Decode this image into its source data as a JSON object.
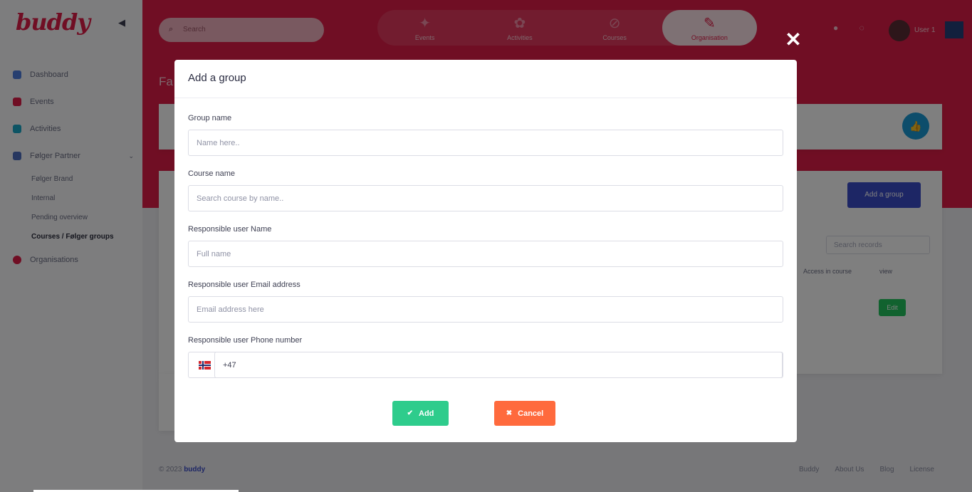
{
  "app": {
    "logo": "buddy",
    "sidebar": {
      "items": [
        {
          "label": "Dashboard",
          "color": "#4f7fe0"
        },
        {
          "label": "Events",
          "color": "#e11d48"
        },
        {
          "label": "Activities",
          "color": "#1aa9c9"
        },
        {
          "label": "Følger Partner",
          "color": "#4f6fc0"
        }
      ],
      "subitems": [
        {
          "label": "Følger Brand"
        },
        {
          "label": "Internal"
        },
        {
          "label": "Pending overview"
        },
        {
          "label": "Courses / Følger groups"
        }
      ],
      "extra_item": {
        "label": "Organisations",
        "color": "#e11d48"
      }
    },
    "header": {
      "search_placeholder": "Search",
      "tabs": [
        {
          "label": "Events"
        },
        {
          "label": "Activities"
        },
        {
          "label": "Courses"
        },
        {
          "label": "Organisation"
        }
      ],
      "user_name": "User 1"
    },
    "page_label": "Fa",
    "bg_button": "Add a group",
    "bg_search": "Search records",
    "bg_headers": [
      "Access in course",
      "view"
    ],
    "bg_tag": "Edit",
    "footer": {
      "copyright": "© 2023",
      "brand": "buddy",
      "links": [
        "Buddy",
        "About Us",
        "Blog",
        "License"
      ]
    }
  },
  "modal": {
    "close_symbol": "✕",
    "title": "Add a group",
    "fields": {
      "group_name": {
        "label": "Group name",
        "placeholder": "Name here.."
      },
      "course_name": {
        "label": "Course name",
        "placeholder": "Search course by name.."
      },
      "user_name": {
        "label": "Responsible user Name",
        "placeholder": "Full name"
      },
      "user_email": {
        "label": "Responsible user Email address",
        "placeholder": "Email address here"
      },
      "user_phone": {
        "label": "Responsible user Phone number",
        "value": "+47",
        "country": "norway-flag-icon"
      }
    },
    "buttons": {
      "add": {
        "label": "Add",
        "icon": "checkmark-icon",
        "color": "#2ecc8c"
      },
      "cancel": {
        "label": "Cancel",
        "icon": "x-icon",
        "color": "#ff6a3d"
      }
    }
  },
  "colors": {
    "brand": "#e11d48",
    "overlay": "rgba(0,0,0,0.5)"
  }
}
